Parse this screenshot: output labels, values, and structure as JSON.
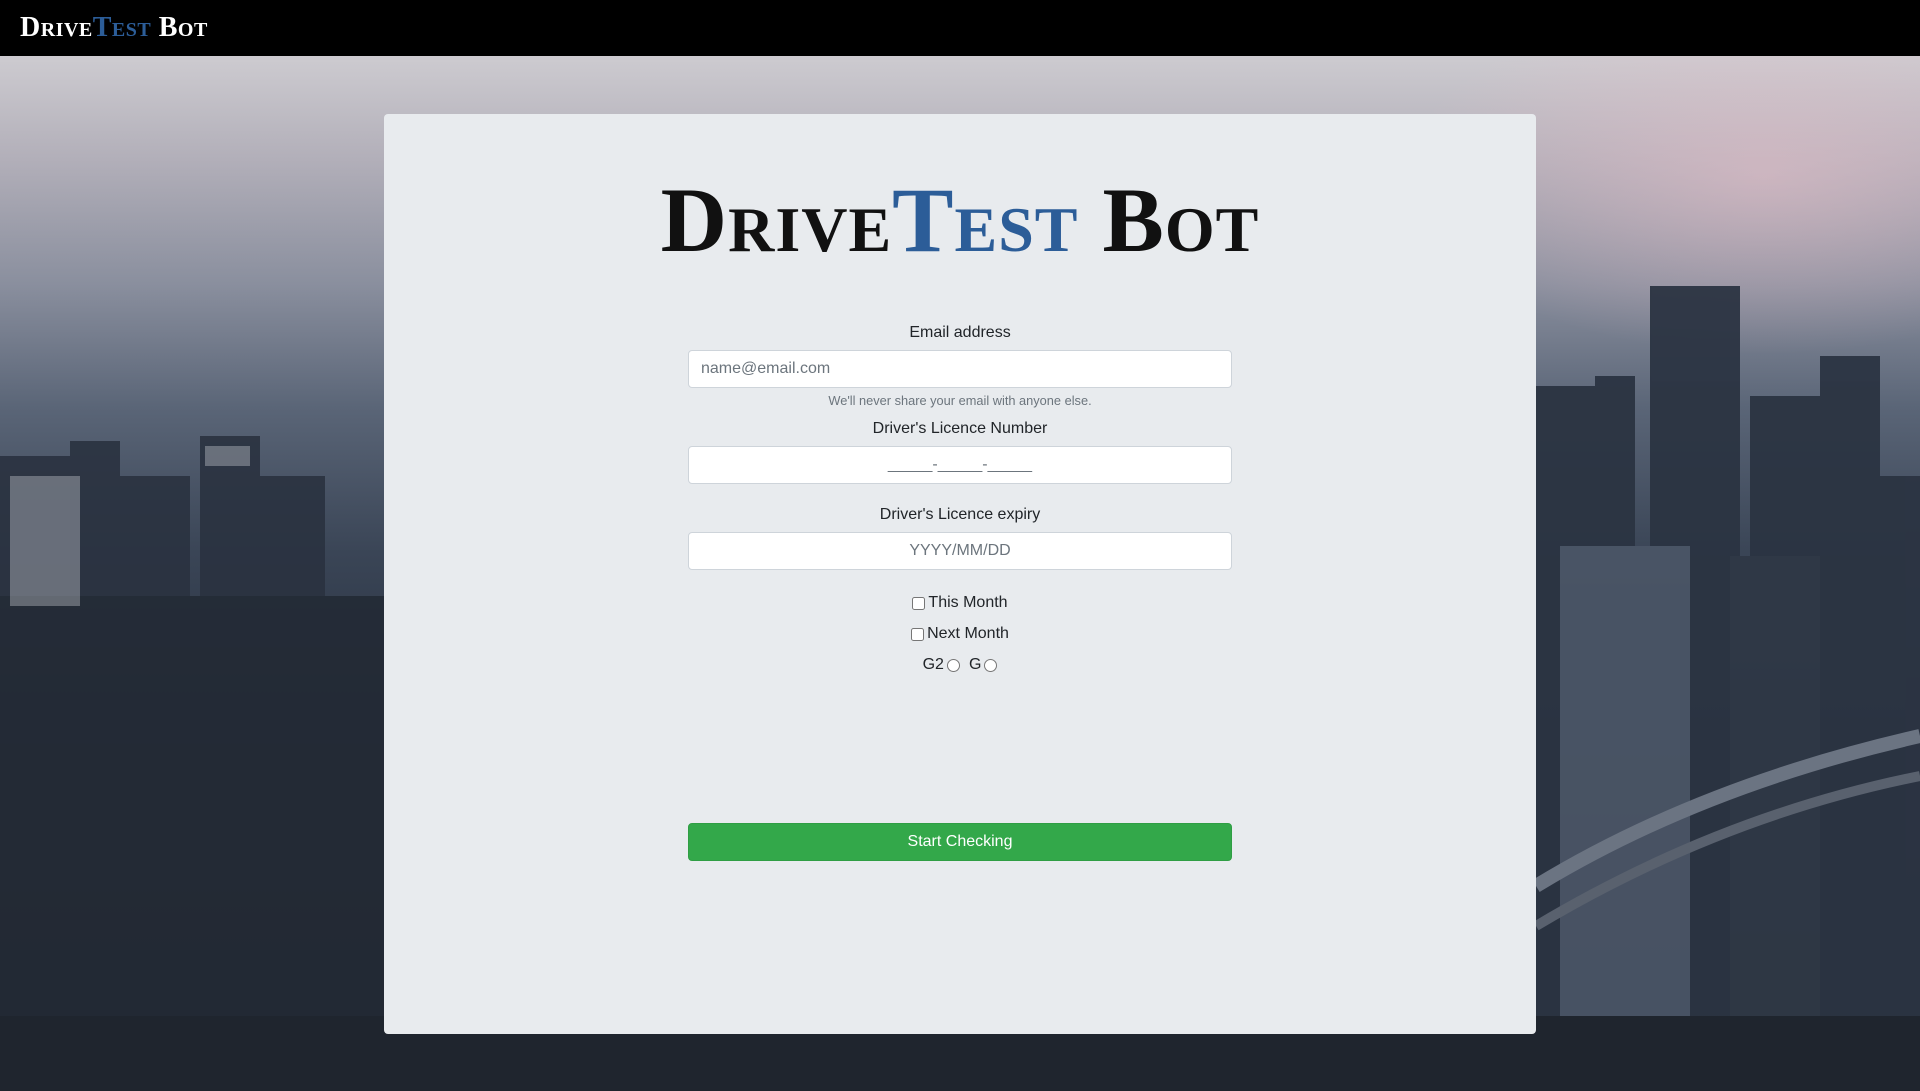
{
  "navbar": {
    "brand_part1": "Drive",
    "brand_part2": "Test",
    "brand_part3": " Bot"
  },
  "hero_title": {
    "part1": "Drive",
    "part2": "Test",
    "part3": " Bot"
  },
  "form": {
    "email_label": "Email address",
    "email_placeholder": "name@email.com",
    "email_help": "We'll never share your email with anyone else.",
    "licence_label": "Driver's Licence Number",
    "licence_value": "_____-_____-_____",
    "expiry_label": "Driver's Licence expiry",
    "expiry_placeholder": "YYYY/MM/DD",
    "this_month_label": "This Month",
    "next_month_label": "Next Month",
    "g2_label": "G2",
    "g_label": "G",
    "submit_label": "Start Checking"
  },
  "colors": {
    "accent": "#2c5d98",
    "button": "#33a84a",
    "card_bg": "#e8ebee",
    "navbar_bg": "#000000"
  }
}
